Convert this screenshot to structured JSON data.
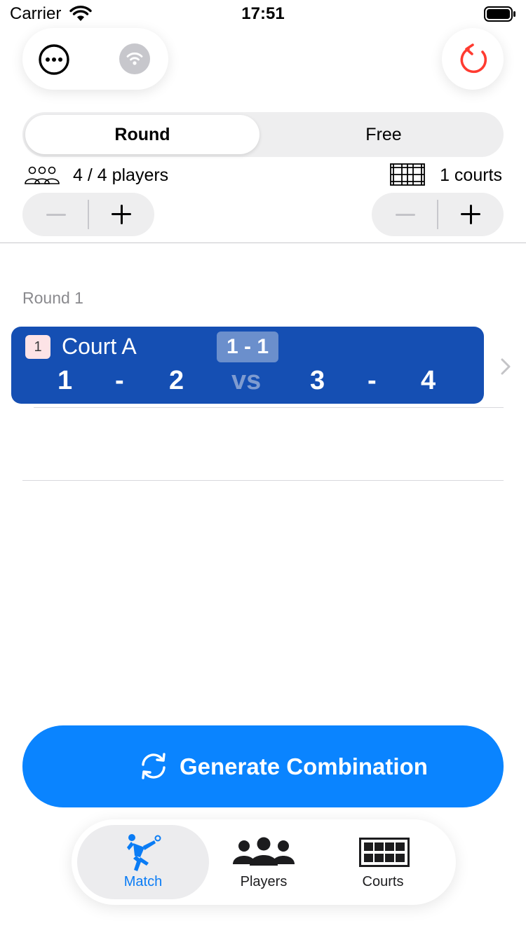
{
  "status_bar": {
    "carrier": "Carrier",
    "time": "17:51"
  },
  "toolbar": {
    "more_icon": "ellipsis-circle-icon",
    "wifi_icon": "wifi-icon",
    "reset_icon": "rotate-left-icon",
    "reset_color": "#ff3b30"
  },
  "mode": {
    "options": [
      "Round",
      "Free"
    ],
    "selected": "Round"
  },
  "settings": {
    "players_text": "4 / 4 players",
    "courts_text": "1 courts",
    "players_icon": "three-people-icon",
    "courts_icon": "court-grid-icon"
  },
  "round": {
    "title": "Round 1",
    "courts": [
      {
        "number": "1",
        "name": "Court A",
        "score": "1 - 1",
        "team_a": [
          "1",
          "2"
        ],
        "team_b": [
          "3",
          "4"
        ],
        "separator": "-",
        "vs_label": "vs"
      }
    ]
  },
  "generate": {
    "label": "Generate Combination",
    "icon": "arrows-cycle-icon",
    "color": "#0a84ff"
  },
  "tabs": [
    {
      "label": "Match",
      "icon": "player-serving-icon",
      "selected": true
    },
    {
      "label": "Players",
      "icon": "group-people-icon",
      "selected": false
    },
    {
      "label": "Courts",
      "icon": "court-grid-icon",
      "selected": false
    }
  ],
  "colors": {
    "accent": "#0a84ff",
    "court_card": "#154fb3"
  }
}
